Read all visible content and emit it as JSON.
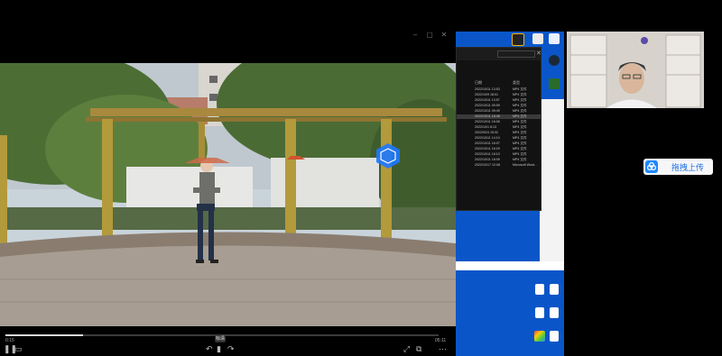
{
  "file_window": {
    "col_date": "日期",
    "col_type": "类型",
    "rows": [
      {
        "date": "2022/10/11 13:53",
        "type": "MP4 文件"
      },
      {
        "date": "2022/10/9 18:01",
        "type": "MP4 文件"
      },
      {
        "date": "2022/10/11 13:57",
        "type": "MP4 文件"
      },
      {
        "date": "2022/10/11 09:59",
        "type": "MP4 文件"
      },
      {
        "date": "2022/10/11 09:49",
        "type": "MP4 文件"
      },
      {
        "date": "2022/10/11 18:48",
        "type": "MP4 文件"
      },
      {
        "date": "2022/10/11 16:08",
        "type": "MP4 文件"
      },
      {
        "date": "2022/10/1 8:13",
        "type": "MP4 文件"
      },
      {
        "date": "2022/9/24 15:32",
        "type": "MP4 文件"
      },
      {
        "date": "2022/10/11 14:10",
        "type": "MP4 文件"
      },
      {
        "date": "2022/10/11 16:07",
        "type": "MP4 文件"
      },
      {
        "date": "2022/10/11 16:29",
        "type": "MP4 文件"
      },
      {
        "date": "2022/10/11 18:10",
        "type": "MP4 文件"
      },
      {
        "date": "2022/10/11 18:09",
        "type": "MP4 文件"
      },
      {
        "date": "2022/10/17 12:08",
        "type": "Microsoft Word..."
      }
    ],
    "selected_index": 5
  },
  "upload": {
    "label": "拖拽上传"
  },
  "player": {
    "quality": "标清",
    "progress": 0.18,
    "time_elapsed": "0:15",
    "time_total": "05:11"
  }
}
